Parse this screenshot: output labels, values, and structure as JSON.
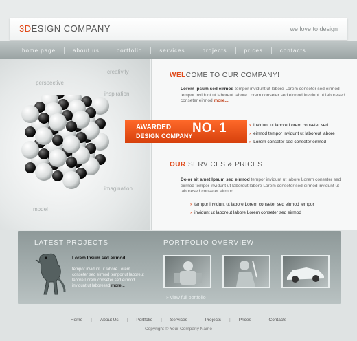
{
  "header": {
    "logo_accent": "3D",
    "logo_rest": "ESIGN COMPANY",
    "tagline": "we love to design"
  },
  "nav": [
    "home page",
    "about us",
    "portfolio",
    "services",
    "projects",
    "prices",
    "contacts"
  ],
  "hero": {
    "words": [
      "creativity",
      "perspective",
      "inspiration",
      "imagination",
      "model"
    ],
    "award": {
      "line1": "AWARDED",
      "big": "NO. 1",
      "line2": "DESIGN COMPANY"
    }
  },
  "welcome": {
    "title_accent": "WEL",
    "title_rest": "COME TO OUR COMPANY!",
    "lead": "Lorem Ipsum sed eirmod",
    "text": " tempor invidunt ut labore Lorem conseter sed eirmod tempor invidunt ut laboreut labore Lorem conseter sed eirmod invidunt ut laboresed conseter eirmod ",
    "more": "more...",
    "bullets": [
      "invidunt ut labore Lorem conseter sed",
      "eirmod tempor invidunt ut laboreut labore",
      "Lorem conseter sed conseter eirmod"
    ]
  },
  "services": {
    "title_accent": "OUR",
    "title_rest": " SERVICES & PRICES",
    "lead": "Dolor sit amet Ipsum sed eirmod",
    "text": " tempor invidunt ut labore Lorem conseter sed eirmod tempor invidunt ut laboreut labore Lorem conseter sed eirmod invidunt ut laboresed conseter eirmod",
    "bullets": [
      "tempor invidunt ut labore Lorem conseter sed eirmod tempor",
      "invidunt ut laboreut labore Lorem conseter sed eirmod"
    ]
  },
  "latest": {
    "title": "LATEST PROJECTS",
    "name": "Lorem Ipsum sed eirmod",
    "text": "tempor invidunt ut labore Lorem conseter sed eirmod tempor ut laboreut labore Lorem conseter sed eirmod invidunt ut laboresed ",
    "more": "more..."
  },
  "portfolio": {
    "title": "PORTFOLIO OVERVIEW",
    "view_all": "»  view full portfolio"
  },
  "footer": {
    "links": [
      "Home",
      "About Us",
      "Portfolio",
      "Services",
      "Projects",
      "Prices",
      "Contacts"
    ],
    "copyright": "Copyright © Your Company Name"
  },
  "colors": {
    "accent": "#e04a1a",
    "band": "#9aa5a5"
  }
}
